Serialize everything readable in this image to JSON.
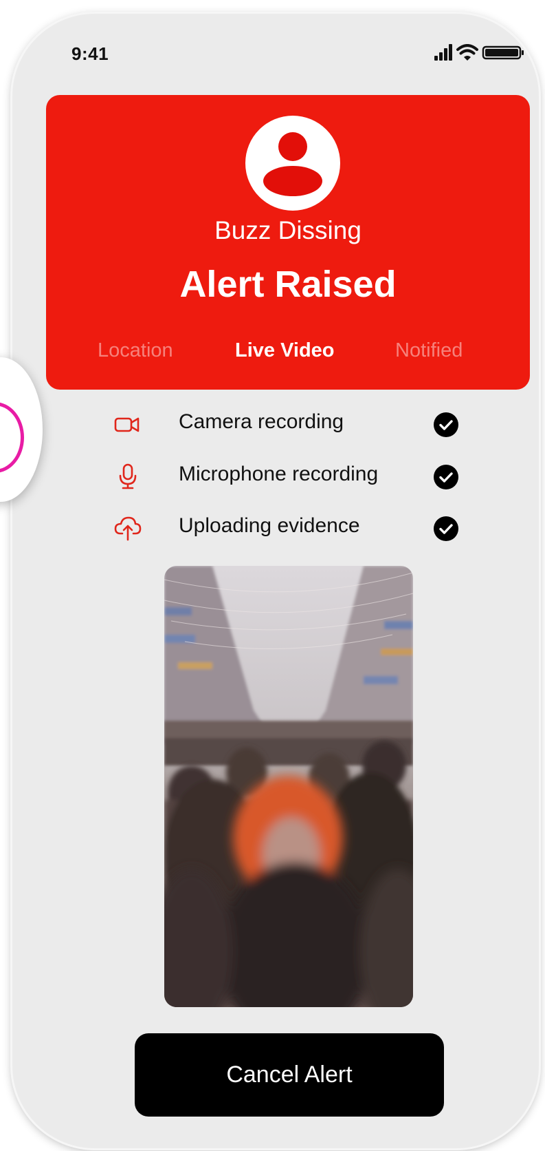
{
  "status_bar": {
    "time": "9:41",
    "icons": [
      "signal-icon",
      "wifi-icon",
      "battery-icon"
    ]
  },
  "alert": {
    "user_name": "Buzz Dissing",
    "title": "Alert Raised",
    "avatar_icon": "user-avatar-icon",
    "tabs": [
      {
        "label": "Location",
        "active": false
      },
      {
        "label": "Live Video",
        "active": true
      },
      {
        "label": "Notified",
        "active": false
      }
    ]
  },
  "recording_status": [
    {
      "icon": "video-camera-icon",
      "label": "Camera recording",
      "done": true,
      "status_icon": "check-circle-icon"
    },
    {
      "icon": "microphone-icon",
      "label": "Microphone recording",
      "done": true,
      "status_icon": "check-circle-icon"
    },
    {
      "icon": "cloud-upload-icon",
      "label": "Uploading evidence",
      "done": true,
      "status_icon": "check-circle-icon"
    }
  ],
  "video": {
    "scene": "live-video-feed"
  },
  "actions": {
    "cancel_label": "Cancel Alert"
  },
  "colors": {
    "alert_red": "#ee1b0f",
    "icon_red": "#e0261b",
    "background": "#ebebeb",
    "button_black": "#000000",
    "side_ring": "#e81ca5"
  }
}
